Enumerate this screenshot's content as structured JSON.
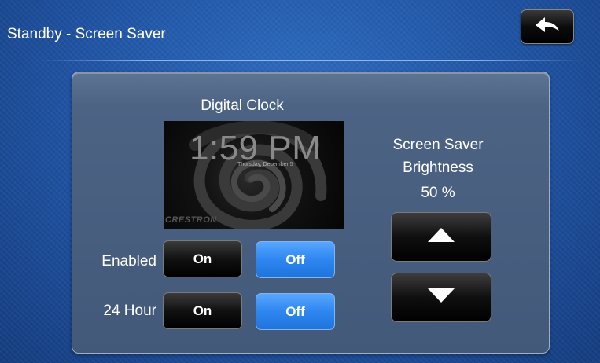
{
  "header": {
    "title": "Standby - Screen Saver",
    "back_icon": "back-arrow-icon"
  },
  "clock": {
    "title": "Digital Clock",
    "preview_time": "1:59 PM",
    "preview_date": "Thursday, December 5",
    "preview_logo": "CRESTRON"
  },
  "enabled": {
    "label": "Enabled",
    "on_label": "On",
    "off_label": "Off",
    "selected": "Off"
  },
  "hour24": {
    "label": "24 Hour",
    "on_label": "On",
    "off_label": "Off",
    "selected": "Off"
  },
  "brightness": {
    "title_line1": "Screen Saver",
    "title_line2": "Brightness",
    "value": "50 %",
    "up_icon": "triangle-up-icon",
    "down_icon": "triangle-down-icon"
  },
  "colors": {
    "background": "#1f53a3",
    "selected_toggle": "#2e86f0",
    "unselected_toggle": "#111111"
  }
}
